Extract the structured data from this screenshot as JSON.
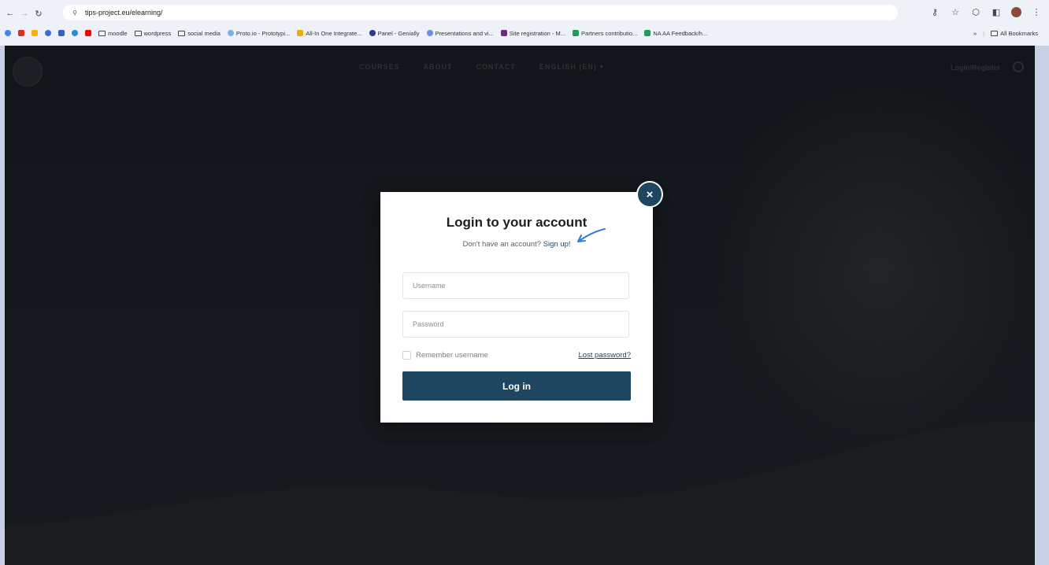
{
  "browser": {
    "url": "tips-project.eu/elearning/",
    "bookmarks": [
      {
        "label": "moodle",
        "type": "folder"
      },
      {
        "label": "wordpress",
        "type": "folder"
      },
      {
        "label": "social media",
        "type": "folder"
      },
      {
        "label": "Proto.io - Prototypi...",
        "color": "#7fb0e8"
      },
      {
        "label": "All-In One Integrate...",
        "color": "#e0b400"
      },
      {
        "label": "Panel - Genially",
        "color": "#2a3a8a"
      },
      {
        "label": "Presentations and vi...",
        "color": "#6a8fe0"
      },
      {
        "label": "Site registration - M...",
        "color": "#6a2a8a"
      },
      {
        "label": "Partners contributio...",
        "color": "#1f9d55"
      },
      {
        "label": "NA AA Feedback/h...",
        "color": "#1f9d55"
      }
    ],
    "all_bookmarks_label": "All Bookmarks"
  },
  "site": {
    "nav_items": [
      "COURSES",
      "ABOUT",
      "CONTACT",
      "ENGLISH (EN) ▾"
    ],
    "login_label": "Login/Register"
  },
  "modal": {
    "title": "Login to your account",
    "subtitle_prefix": "Don't have an account? ",
    "signup_link": "Sign up!",
    "username_placeholder": "Username",
    "password_placeholder": "Password",
    "remember_label": "Remember username",
    "lost_password_label": "Lost password?",
    "login_button": "Log in",
    "close_symbol": "×"
  },
  "colors": {
    "accent": "#1f4661",
    "page_bg": "#15191d",
    "arrow": "#2a7fd4"
  }
}
